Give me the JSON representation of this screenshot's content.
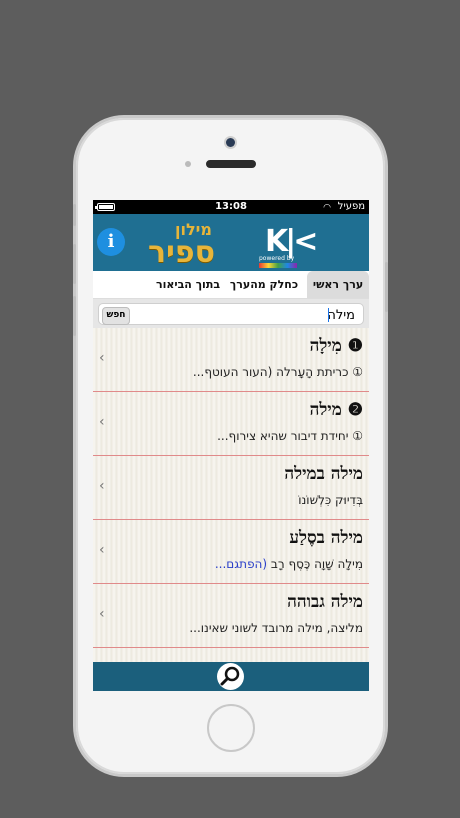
{
  "status_bar": {
    "time": "13:08",
    "carrier": "מפעיל"
  },
  "banner": {
    "logo_main": "ספיר",
    "logo_sub": "מילון",
    "logo_k": "K|<",
    "powered_by": "powered by",
    "info_label": "i"
  },
  "tabs": [
    {
      "label": "ערך ראשי",
      "active": true
    },
    {
      "label": "כחלק מהערך",
      "active": false
    },
    {
      "label": "בתוך הביאור",
      "active": false
    }
  ],
  "search": {
    "value": "מילה",
    "button_label": "חפש"
  },
  "results": [
    {
      "headword": "❶ מִילָה",
      "definition": "① כריתת הָעָרלה (העור העוטף...",
      "extra": ""
    },
    {
      "headword": "❷ מילה",
      "definition": "① יחידת דיבור שהיא צירוף...",
      "extra": ""
    },
    {
      "headword": "מילה במילה",
      "definition": "בְּדִיוּק כִּלְשׁוֹנוֹ",
      "extra": ""
    },
    {
      "headword": "מילה בסֶלַע",
      "definition": "מִילָה שָׁוָה כֶּסֶף רָב",
      "extra": "(הפתגם..."
    },
    {
      "headword": "מילה גבוהה",
      "definition": "מליצה, מילה מרובד לשוני שאינו...",
      "extra": ""
    }
  ],
  "icons": {
    "chevron": "‹",
    "search": "magnifier-icon"
  },
  "colors": {
    "banner": "#1f6f92",
    "bottom_bar": "#1b5f7c",
    "logo_gold": "#e7b53a",
    "divider": "#e08a8a"
  }
}
